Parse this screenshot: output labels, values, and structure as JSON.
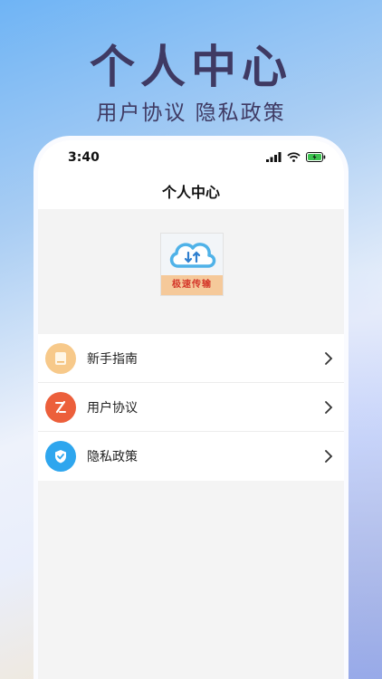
{
  "hero": {
    "title": "个人中心",
    "subtitle": "用户协议 隐私政策"
  },
  "status_bar": {
    "time": "3:40"
  },
  "navbar": {
    "title": "个人中心"
  },
  "logo": {
    "text": "极速传输"
  },
  "menu": [
    {
      "label": "新手指南",
      "icon": "book-icon",
      "color": "#f7c98a"
    },
    {
      "label": "用户协议",
      "icon": "edit-icon",
      "color": "#ec5f3b"
    },
    {
      "label": "隐私政策",
      "icon": "shield-check-icon",
      "color": "#2ea6ee"
    }
  ]
}
